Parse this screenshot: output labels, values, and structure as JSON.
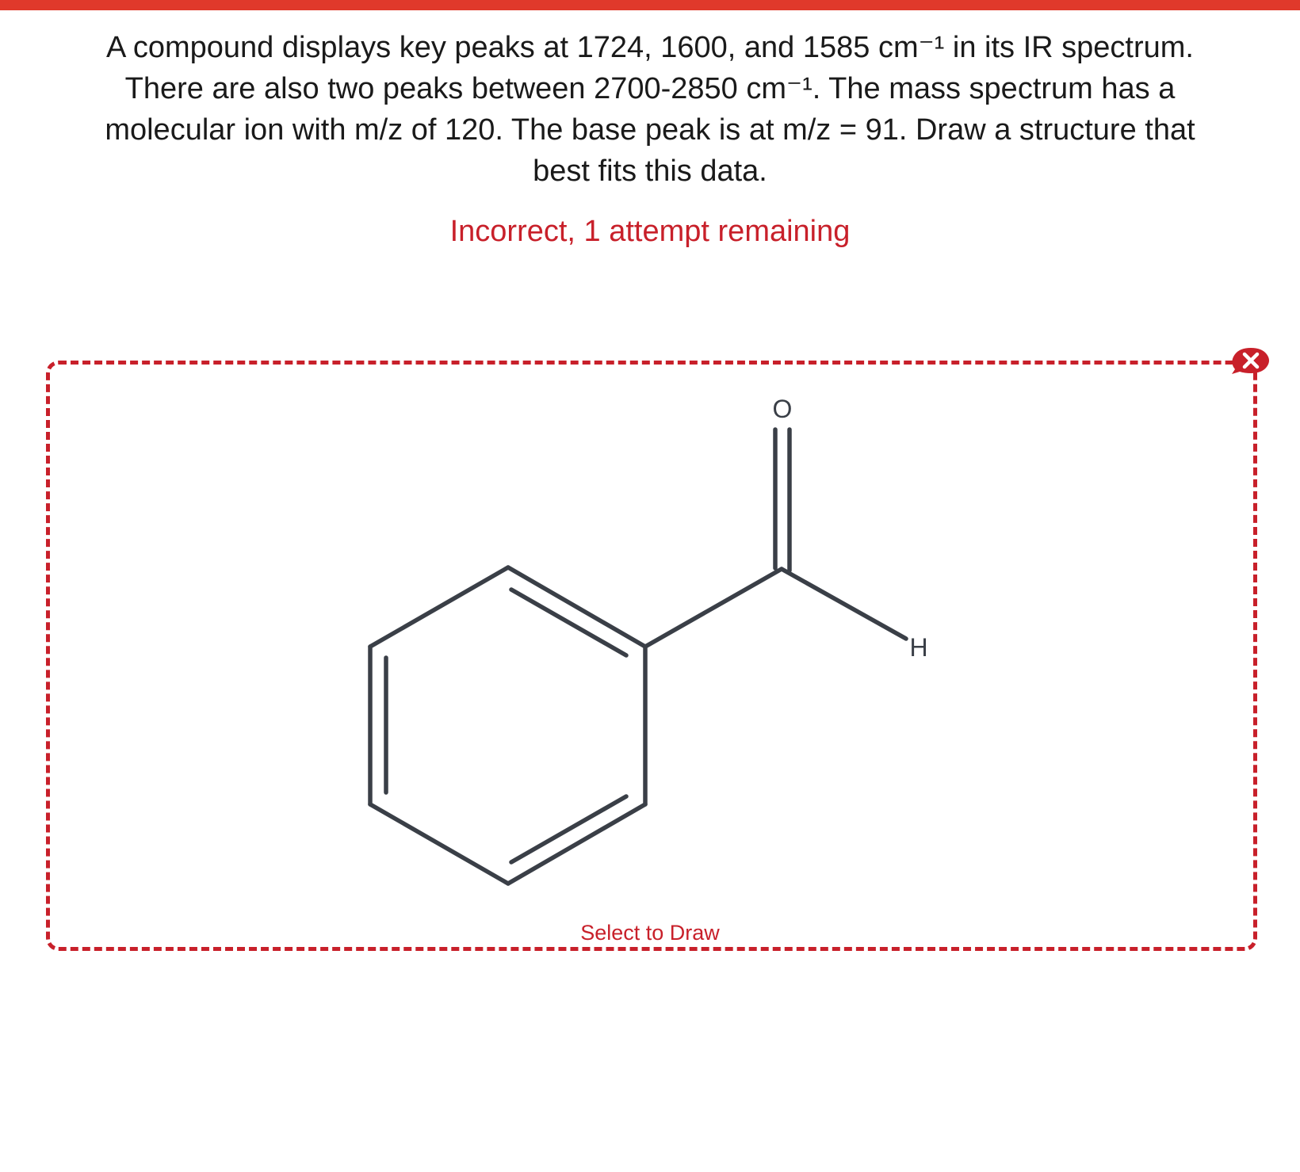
{
  "question": {
    "lines": [
      "A compound displays key peaks at 1724, 1600, and 1585 cm⁻¹ in its IR spectrum.",
      "There are also two peaks between 2700-2850 cm⁻¹.  The mass spectrum has a",
      "molecular ion with m/z of 120. The base peak is at m/z = 91. Draw a structure that",
      "best fits this data."
    ]
  },
  "status": "Incorrect, 1 attempt remaining",
  "drawing": {
    "select_label": "Select to Draw",
    "atoms": {
      "oxygen": "O",
      "hydrogen": "H"
    }
  },
  "colors": {
    "accent": "#e0392b",
    "error_red": "#c8202a",
    "bond": "#3a3f47",
    "text": "#1a1a1a"
  },
  "icons": {
    "remove": "close-icon"
  }
}
